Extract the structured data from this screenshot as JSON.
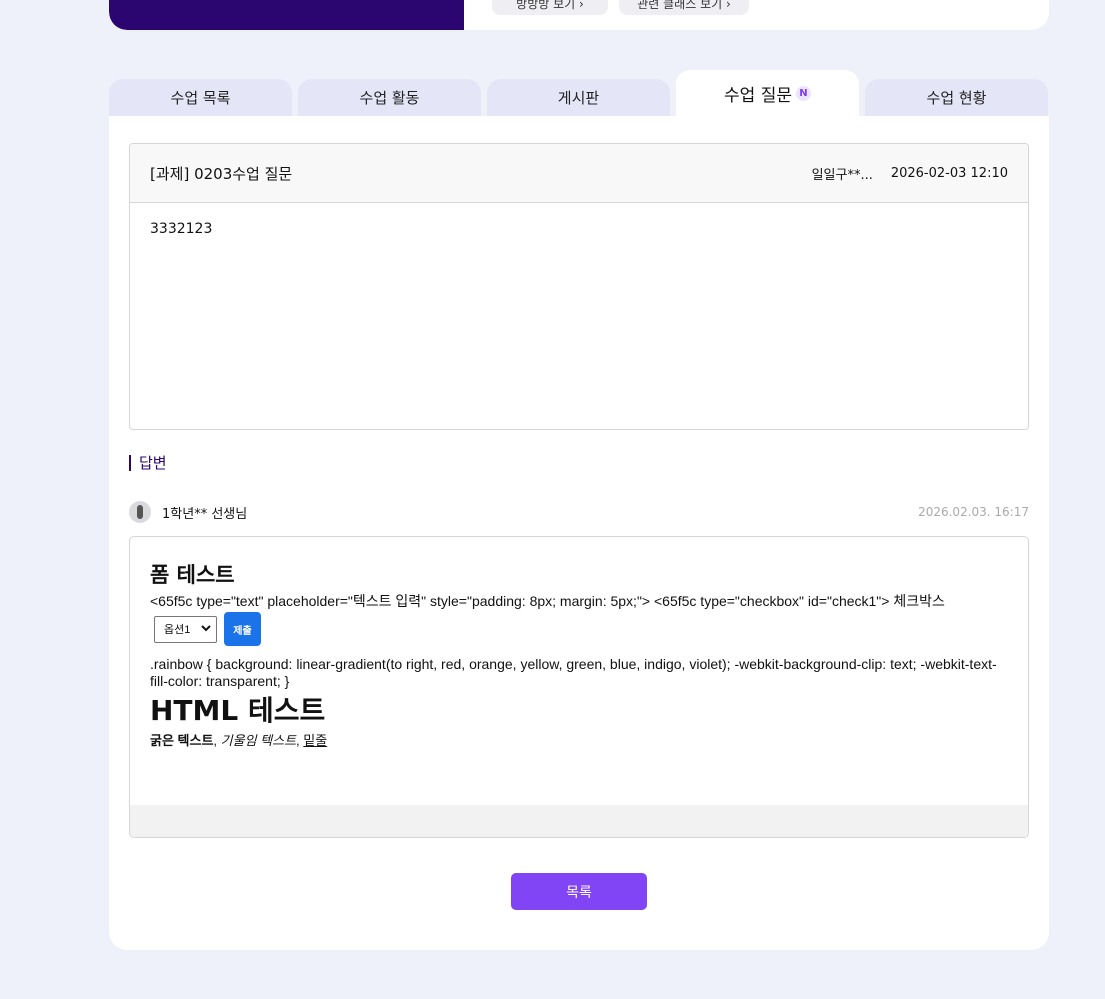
{
  "header": {
    "buttons": [
      {
        "label": "방방방 보기 ›"
      },
      {
        "label": "관련 클래스 보기 ›"
      }
    ]
  },
  "tabs": [
    {
      "label": "수업 목록"
    },
    {
      "label": "수업 활동"
    },
    {
      "label": "게시판"
    },
    {
      "label": "수업 질문",
      "badge": "N",
      "active": true
    },
    {
      "label": "수업 현황"
    }
  ],
  "question": {
    "title": "[과제] 0203수업 질문",
    "author": "일일구**...",
    "date": "2026-02-03 12:10",
    "body": "3332123"
  },
  "answer": {
    "section_label": "답변",
    "author": "1학년** 선생님",
    "date": "2026.02.03. 16:17",
    "heading1": "폼 테스트",
    "code_line": "<65f5c type=\"text\" placeholder=\"텍스트 입력\" style=\"padding: 8px; margin: 5px;\"> <65f5c type=\"checkbox\" id=\"check1\"> 체크박스",
    "select_value": "옵션1",
    "submit_label": "제출",
    "css_line": ".rainbow { background: linear-gradient(to right, red, orange, yellow, green, blue, indigo, violet); -webkit-background-clip: text; -webkit-text-fill-color: transparent; }",
    "heading2": "HTML 테스트",
    "bold_text": "굵은 텍스트",
    "italic_text": "기울임 텍스트",
    "underline_text": "밑줄",
    "separator": ", "
  },
  "footer": {
    "list_button": "목록"
  },
  "colors": {
    "brand_dark": "#2b0670",
    "accent": "#8145f5",
    "submit_blue": "#1a73e8",
    "page_bg": "#eef0fa"
  }
}
